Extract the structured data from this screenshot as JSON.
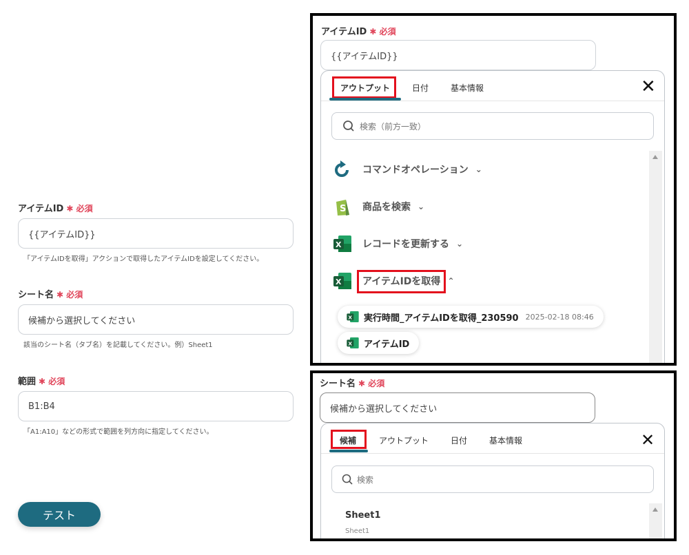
{
  "left_form": {
    "item_id": {
      "label": "アイテムID",
      "required": "必須",
      "value": "{{アイテムID}}",
      "help": "「アイテムIDを取得」アクションで取得したアイテムIDを設定してください。"
    },
    "sheet_name": {
      "label": "シート名",
      "required": "必須",
      "placeholder": "候補から選択してください",
      "help": "該当のシート名（タブ名）を記載してください。例）Sheet1"
    },
    "range": {
      "label": "範囲",
      "required": "必須",
      "value": "B1:B4",
      "help": "「A1:A10」などの形式で範囲を列方向に指定してください。"
    },
    "test_button": "テスト"
  },
  "top_panel": {
    "label": "アイテムID",
    "required": "必須",
    "value": "{{アイテムID}}",
    "tabs": [
      "アウトプット",
      "日付",
      "基本情報"
    ],
    "search_placeholder": "検索（前方一致）",
    "rows": [
      {
        "label": "コマンドオペレーション",
        "icon": "refresh-icon"
      },
      {
        "label": "商品を検索",
        "icon": "shopify-icon"
      },
      {
        "label": "レコードを更新する",
        "icon": "excel-icon"
      },
      {
        "label": "アイテムIDを取得",
        "icon": "excel-icon"
      }
    ],
    "chip_main": {
      "label": "実行時間_アイテムIDを取得_230590",
      "date": "2025-02-18 08:46"
    },
    "chip_item": "アイテムID"
  },
  "bottom_panel": {
    "label": "シート名",
    "required": "必須",
    "placeholder": "候補から選択してください",
    "tabs": [
      "候補",
      "アウトプット",
      "日付",
      "基本情報"
    ],
    "search_placeholder": "検索",
    "option_title": "Sheet1",
    "option_sub": "Sheet1"
  },
  "colors": {
    "accent": "#1e6b80",
    "required": "#e0455a",
    "highlight": "#e3101d",
    "excel": "#1d7a45",
    "shopify": "#95bf47"
  }
}
